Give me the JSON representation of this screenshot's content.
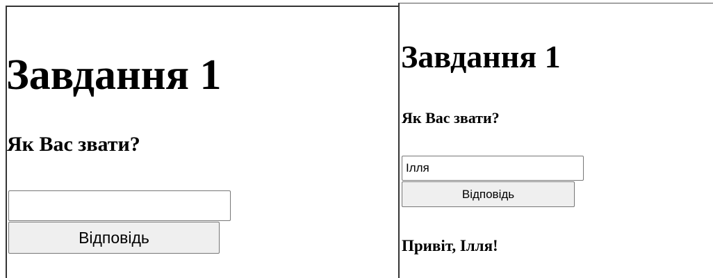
{
  "panels": {
    "before": {
      "title": "Завдання 1",
      "question": "Як Вас звати?",
      "name_value": "",
      "button_label": "Відповідь"
    },
    "after": {
      "title": "Завдання 1",
      "question": "Як Вас звати?",
      "name_value": "Ілля",
      "button_label": "Відповідь",
      "greeting": "Привіт, Ілля!"
    }
  }
}
